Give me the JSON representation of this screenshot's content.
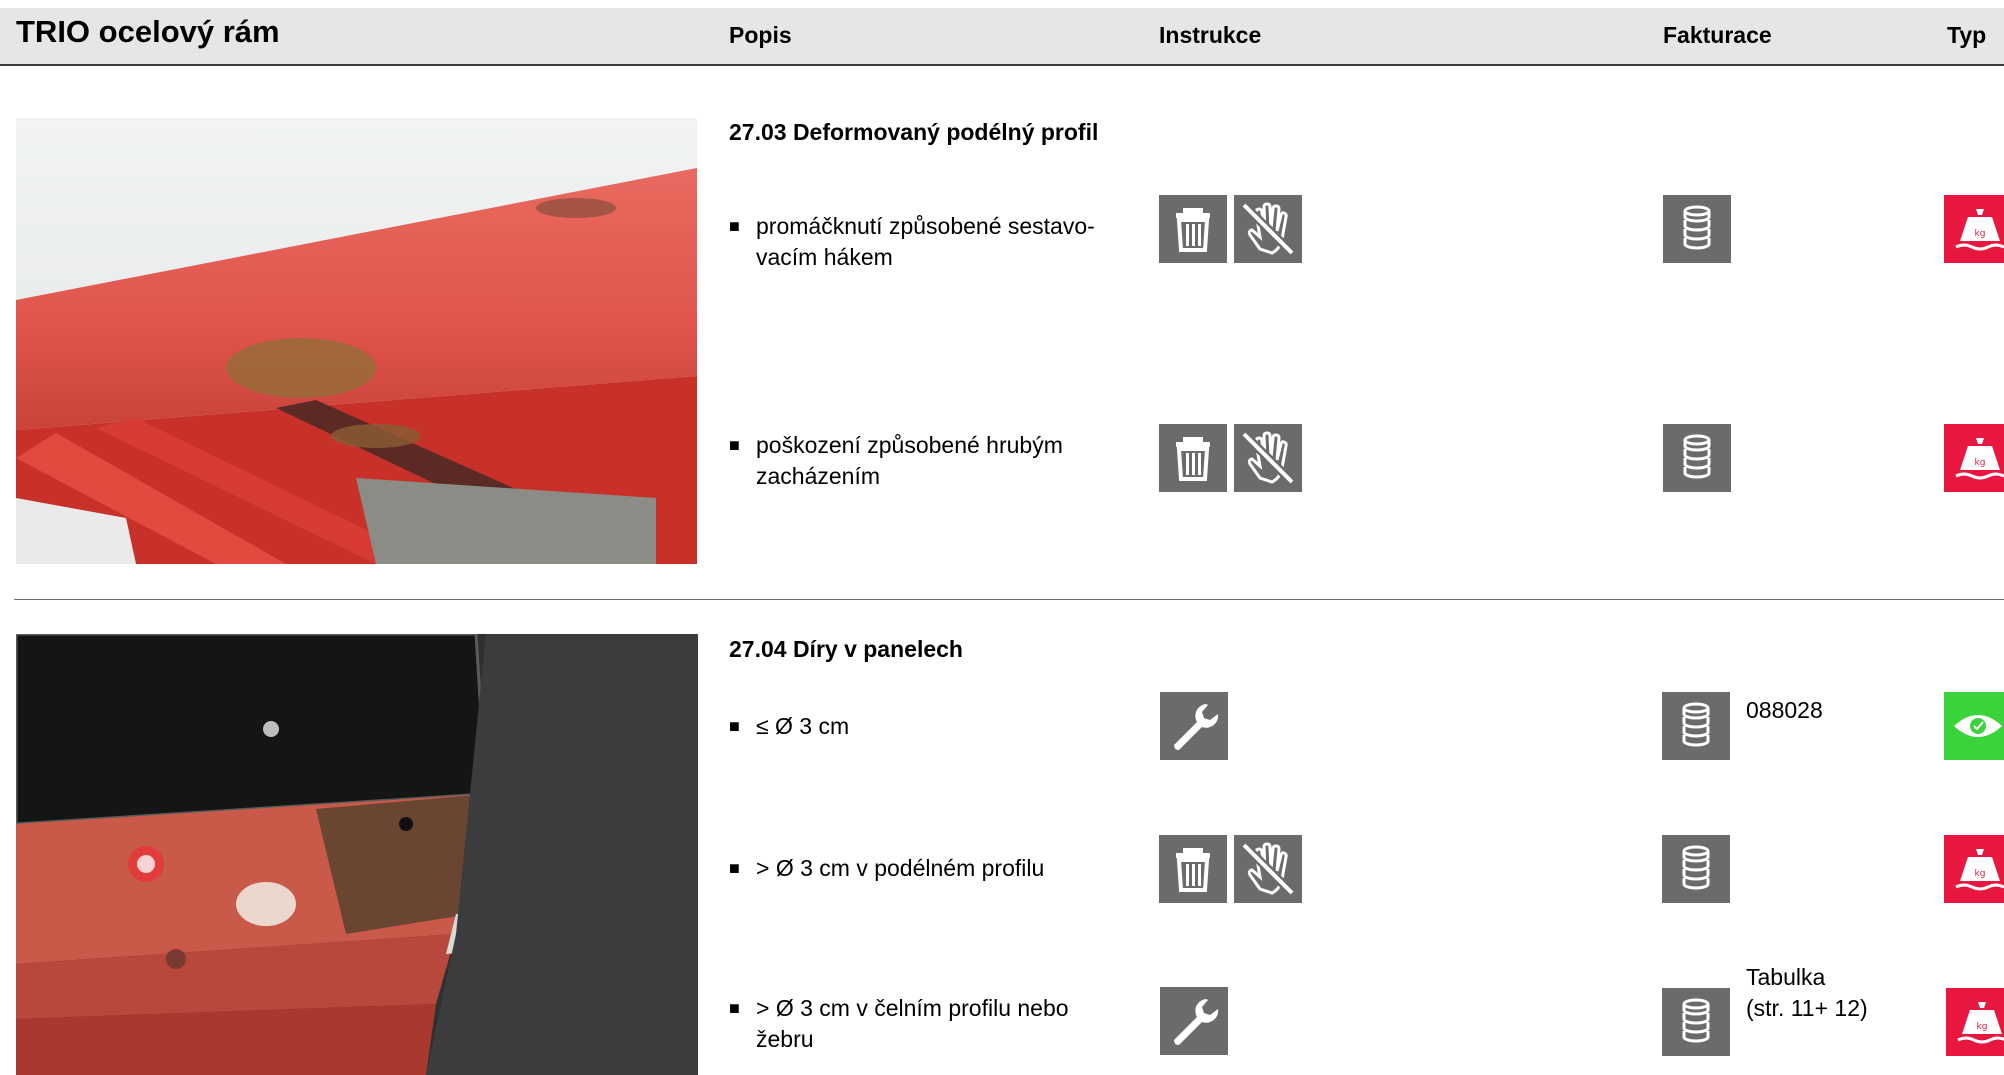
{
  "document": {
    "title": "TRIO ocelový rám"
  },
  "columns": {
    "popis": "Popis",
    "instrukce": "Instrukce",
    "fakturace": "Fakturace",
    "typ": "Typ"
  },
  "colors": {
    "scrap": "#e8173f",
    "visual": "#3ad33a",
    "icon_gray": "#6b6b6b",
    "header_bg": "#e6e6e6"
  },
  "sections": [
    {
      "title": "27.03 Deformovaný podélný profil",
      "photo": "red-steel-frame-photo-icon",
      "items": [
        {
          "text": "promáčknutí způsobené sestavo-\nvacím hákem",
          "instructions": [
            "trash-icon",
            "no-hand-repair-icon"
          ],
          "billing_icon": "coins-stack-icon",
          "billing_note": "",
          "type": "scrap-weight-icon"
        },
        {
          "text": "poškození způsobené hrubým\nzacházením",
          "instructions": [
            "trash-icon",
            "no-hand-repair-icon"
          ],
          "billing_icon": "coins-stack-icon",
          "billing_note": "",
          "type": "scrap-weight-icon"
        }
      ]
    },
    {
      "title": "27.04 Díry v panelech",
      "photo": "panel-holes-photo-icon",
      "items": [
        {
          "text": "≤ Ø 3 cm",
          "instructions": [
            "wrench-icon"
          ],
          "billing_icon": "coins-stack-icon",
          "billing_note": "088028",
          "type": "visual-eye-icon"
        },
        {
          "text": "> Ø 3 cm v podélném profilu",
          "instructions": [
            "trash-icon",
            "no-hand-repair-icon"
          ],
          "billing_icon": "coins-stack-icon",
          "billing_note": "",
          "type": "scrap-weight-icon"
        },
        {
          "text": "> Ø 3 cm v čelním profilu nebo\nžebru",
          "instructions": [
            "wrench-icon"
          ],
          "billing_icon": "coins-stack-icon",
          "billing_note": "Tabulka\n(str. 11+ 12)",
          "type": "scrap-weight-icon"
        }
      ]
    }
  ],
  "bullet_glyph": "■"
}
